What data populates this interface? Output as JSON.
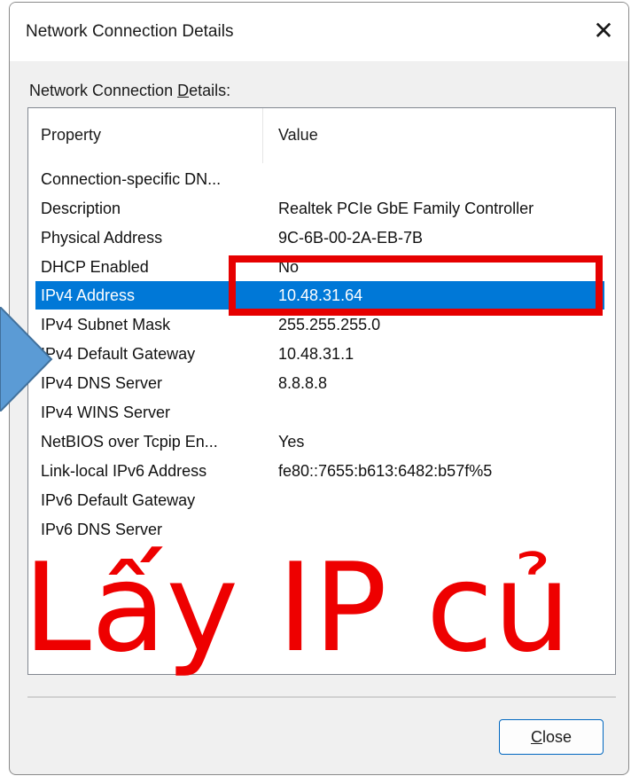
{
  "dialog": {
    "title": "Network Connection Details",
    "close_glyph": "✕",
    "group_label_prefix": "Network Connection ",
    "group_label_underlined": "D",
    "group_label_suffix": "etails:",
    "columns": {
      "property": "Property",
      "value": "Value"
    },
    "rows": [
      {
        "property": "Connection-specific DN...",
        "value": ""
      },
      {
        "property": "Description",
        "value": "Realtek PCIe GbE Family Controller"
      },
      {
        "property": "Physical Address",
        "value": "9C-6B-00-2A-EB-7B"
      },
      {
        "property": "DHCP Enabled",
        "value": "No"
      },
      {
        "property": "IPv4 Address",
        "value": "10.48.31.64",
        "selected": true
      },
      {
        "property": "IPv4 Subnet Mask",
        "value": "255.255.255.0"
      },
      {
        "property": "IPv4 Default Gateway",
        "value": "10.48.31.1"
      },
      {
        "property": "IPv4 DNS Server",
        "value": "8.8.8.8"
      },
      {
        "property": "IPv4 WINS Server",
        "value": ""
      },
      {
        "property": "NetBIOS over Tcpip En...",
        "value": "Yes"
      },
      {
        "property": "Link-local IPv6 Address",
        "value": "fe80::7655:b613:6482:b57f%5"
      },
      {
        "property": "IPv6 Default Gateway",
        "value": ""
      },
      {
        "property": "IPv6 DNS Server",
        "value": ""
      }
    ],
    "close_button_underlined": "C",
    "close_button_rest": "lose"
  },
  "overlay": {
    "caption": "Lấy IP củ",
    "caption_color": "#ee0000",
    "highlight_color": "#e60000",
    "arrow_color": "#5b9bd5"
  },
  "colors": {
    "selection": "#0078d7",
    "button_border": "#0067c0"
  }
}
